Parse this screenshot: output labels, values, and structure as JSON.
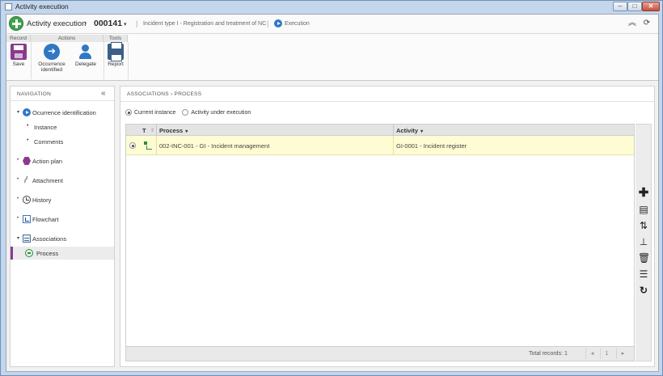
{
  "window": {
    "title": "Activity execution",
    "min": "–",
    "max": "□",
    "close": "✕"
  },
  "header": {
    "title": "Activity execution",
    "separator": "›",
    "code": "000141",
    "code_caret": "▾",
    "divider": "|",
    "incident_type": "Incident type I - Registration and treatment of NC",
    "status": "Execution",
    "collapse_icon": "︽",
    "refresh_icon": "⟳"
  },
  "ribbon": {
    "groups": {
      "record": "Record",
      "actions": "Actions",
      "tools": "Tools"
    },
    "buttons": {
      "save": "Save",
      "occurrence_identified": "Occurrence identified",
      "delegate": "Delegate",
      "report": "Report"
    }
  },
  "navigation": {
    "title": "NAVIGATION",
    "collapse": "«",
    "expand_glyph": "▾",
    "bullet": "•",
    "items": [
      {
        "label": "Ocurrence identification",
        "icon": "play-circle-icon"
      },
      {
        "label": "Instance"
      },
      {
        "label": "Comments"
      },
      {
        "label": "Action plan",
        "icon": "hexagon-icon"
      },
      {
        "label": "Attachment",
        "icon": "paperclip-icon"
      },
      {
        "label": "History",
        "icon": "history-icon"
      },
      {
        "label": "Flowchart",
        "icon": "flowchart-icon"
      },
      {
        "label": "Associations",
        "icon": "associations-icon"
      },
      {
        "label": "Process",
        "icon": "process-icon",
        "selected": true
      }
    ]
  },
  "main": {
    "breadcrumb": "ASSOCIATIONS  ›  PROCESS",
    "filter": {
      "current_instance": "Current instance",
      "activity_under_execution": "Activity under execution",
      "selected": "current_instance"
    },
    "grid": {
      "columns": {
        "t": "T",
        "t_sort": "⇕",
        "process": "Process",
        "activity": "Activity",
        "caret": "▾"
      },
      "rows": [
        {
          "process": "002-INC-001 - GI - Incident management",
          "activity": "GI-0001 - Incident register"
        }
      ],
      "footer": {
        "total": "Total records: 1",
        "prev": "◂",
        "page": "1",
        "next": "▸"
      }
    },
    "side_tools": {
      "add": "✚",
      "view": "▤",
      "assoc": "⇅",
      "tree": "⊥",
      "delete": "🗑",
      "list": "☰",
      "refresh": "↻"
    }
  },
  "colors": {
    "accent": "#8a3a8f",
    "blue": "#2f78c4",
    "selected_row": "#fdfcd2"
  }
}
